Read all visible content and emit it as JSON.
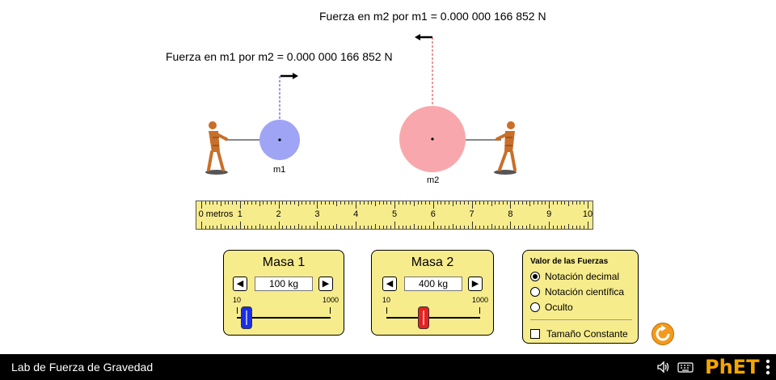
{
  "force_labels": {
    "m1": "Fuerza en m1 por m2 = 0.000 000 166 852 N",
    "m2": "Fuerza en m2 por m1 = 0.000 000 166 852 N"
  },
  "masses": {
    "m1": {
      "label": "m1",
      "color": "#9fa4f5"
    },
    "m2": {
      "label": "m2",
      "color": "#f8a8ac"
    }
  },
  "ruler": {
    "unit_label": "0 metros",
    "numbers": [
      "1",
      "2",
      "3",
      "4",
      "5",
      "6",
      "7",
      "8",
      "9",
      "10"
    ]
  },
  "panels": {
    "mass1": {
      "title": "Masa 1",
      "value": "100 kg",
      "min": "10",
      "max": "1000",
      "level": 0.1,
      "thumb_color": "#1a2ee8"
    },
    "mass2": {
      "title": "Masa 2",
      "value": "400 kg",
      "min": "10",
      "max": "1000",
      "level": 0.4,
      "thumb_color": "#e8201e"
    }
  },
  "force_values": {
    "title": "Valor de las Fuerzas",
    "options": [
      "Notación decimal",
      "Notación científica",
      "Oculto"
    ],
    "selected": 0,
    "constant_size_label": "Tamaño Constante",
    "constant_size_checked": false
  },
  "navbar": {
    "title": "Lab de Fuerza de Gravedad",
    "logo": "PhET"
  },
  "icons": [
    "sound-icon",
    "keyboard-icon",
    "reset-icon",
    "menu-icon"
  ],
  "colors": {
    "panel": "#f7ec8c",
    "reset": "#f39a1c"
  }
}
